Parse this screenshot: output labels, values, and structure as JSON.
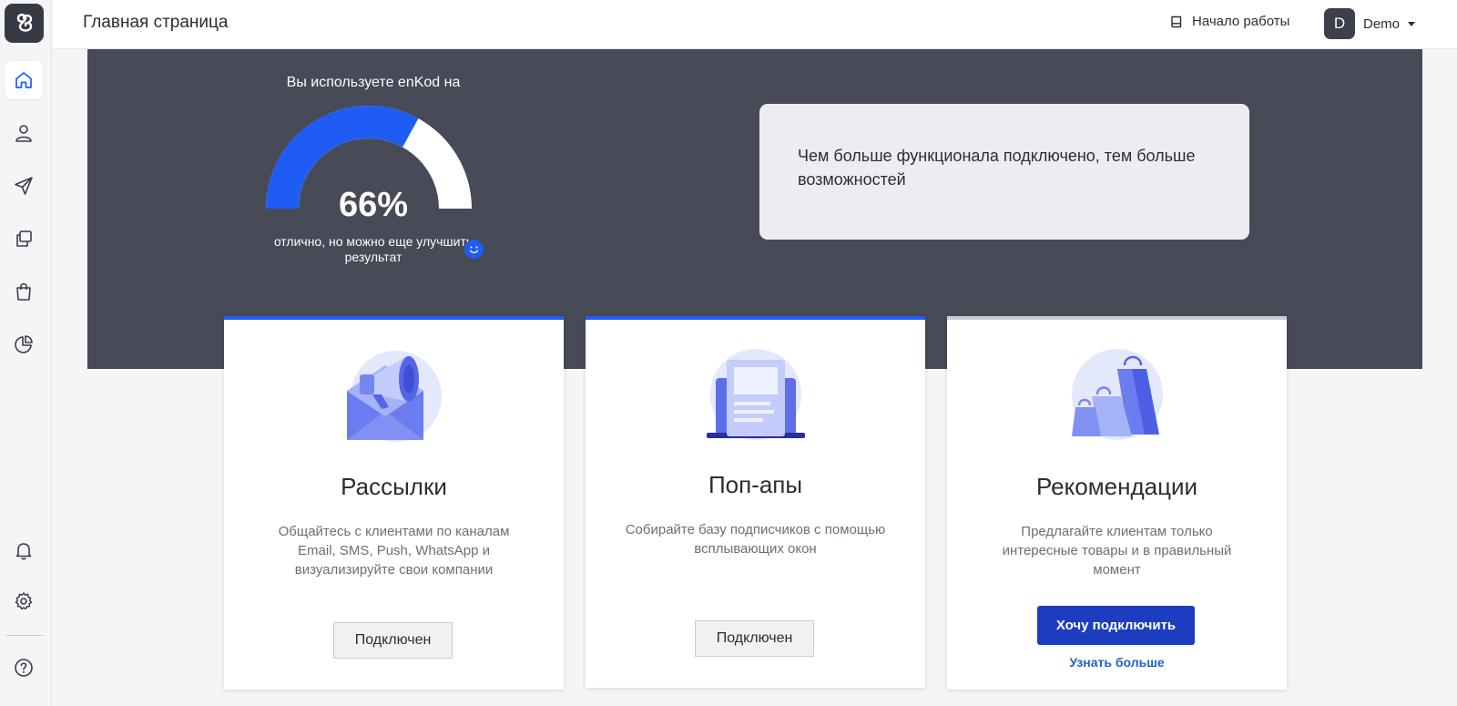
{
  "topbar": {
    "page_title": "Главная страница",
    "guide_label": "Начало работы",
    "user_initial": "D",
    "user_name": "Demo"
  },
  "sidebar": {
    "items": [
      {
        "icon": "home-icon",
        "active": true
      },
      {
        "icon": "user-icon",
        "active": false
      },
      {
        "icon": "paper-plane-icon",
        "active": false
      },
      {
        "icon": "copy-icon",
        "active": false
      },
      {
        "icon": "shopping-bag-icon",
        "active": false
      },
      {
        "icon": "pie-chart-icon",
        "active": false
      }
    ],
    "bottom_items": [
      {
        "icon": "bell-icon"
      },
      {
        "icon": "gear-icon"
      },
      {
        "icon": "help-icon"
      }
    ]
  },
  "hero": {
    "gauge_title": "Вы используете enKod на",
    "gauge_percent": 66,
    "gauge_value_label": "66%",
    "gauge_caption": "отлично, но можно еще улучшить результат",
    "info_text": "Чем больше функционала подключено, тем больше возможностей"
  },
  "cards": [
    {
      "title": "Рассылки",
      "description": "Общайтесь с клиентами по каналам Email, SMS, Push, WhatsApp и визуализируйте свои компании",
      "status_label": "Подключен",
      "icon": "megaphone-envelope-icon"
    },
    {
      "title": "Поп-апы",
      "description": "Собирайте базу подписчиков с помощью всплывающих окон",
      "status_label": "Подключен",
      "icon": "laptop-popup-icon"
    },
    {
      "title": "Рекомендации",
      "description": "Предлагайте клиентам только интересные товары и в правильный момент",
      "action_label": "Хочу подключить",
      "learn_more_label": "Узнать больше",
      "icon": "shopping-bags-icon"
    }
  ],
  "colors": {
    "accent": "#1e5cf5",
    "hero_bg": "#474a57",
    "primary_button": "#1c3dbf",
    "link": "#1c62c8"
  }
}
